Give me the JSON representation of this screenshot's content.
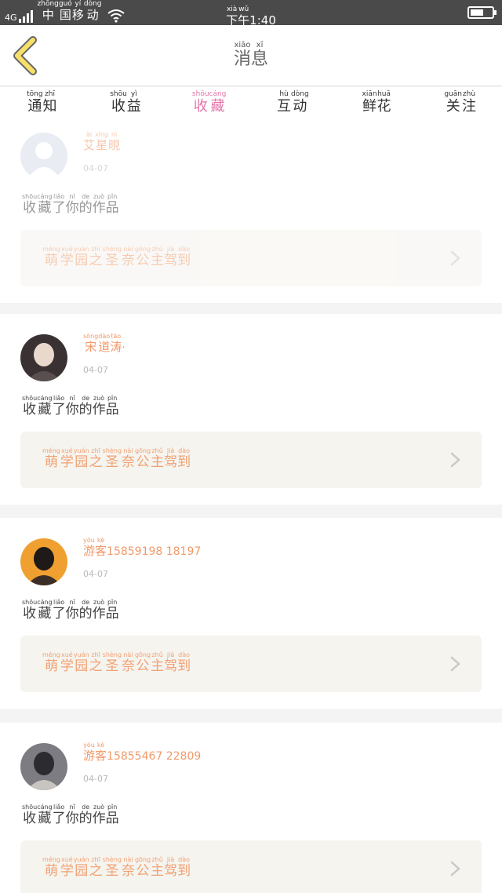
{
  "status_bar": {
    "network": "4G",
    "carrier": [
      {
        "char": "中",
        "py": "zhōng"
      },
      {
        "char": "国",
        "py": "guó"
      },
      {
        "char": "移",
        "py": "yí"
      },
      {
        "char": "动",
        "py": "dòng"
      }
    ],
    "time": [
      {
        "char": "下",
        "py": "xià"
      },
      {
        "char": "午",
        "py": "wǔ"
      },
      {
        "char": "1:40",
        "py": ""
      }
    ],
    "battery_level": 0.6
  },
  "header": {
    "back_icon": "chevron-left-icon",
    "title": [
      {
        "char": "消",
        "py": "xiāo"
      },
      {
        "char": "息",
        "py": "xī"
      }
    ]
  },
  "tabs": [
    {
      "chars": [
        {
          "char": "通",
          "py": "tōng"
        },
        {
          "char": "知",
          "py": "zhī"
        }
      ],
      "active": false
    },
    {
      "chars": [
        {
          "char": "收",
          "py": "shōu"
        },
        {
          "char": "益",
          "py": "yì"
        }
      ],
      "active": false
    },
    {
      "chars": [
        {
          "char": "收",
          "py": "shōu"
        },
        {
          "char": "藏",
          "py": "cáng"
        }
      ],
      "active": true
    },
    {
      "chars": [
        {
          "char": "互",
          "py": "hù"
        },
        {
          "char": "动",
          "py": "dòng"
        }
      ],
      "active": false
    },
    {
      "chars": [
        {
          "char": "鲜",
          "py": "xiān"
        },
        {
          "char": "花",
          "py": "huā"
        }
      ],
      "active": false
    },
    {
      "chars": [
        {
          "char": "关",
          "py": "guān"
        },
        {
          "char": "注",
          "py": "zhù"
        }
      ],
      "active": false
    }
  ],
  "action_text": [
    {
      "char": "收",
      "py": "shōu"
    },
    {
      "char": "藏",
      "py": "cáng"
    },
    {
      "char": "了",
      "py": "liǎo"
    },
    {
      "char": "你",
      "py": "nǐ"
    },
    {
      "char": "的",
      "py": "de"
    },
    {
      "char": "作",
      "py": "zuò"
    },
    {
      "char": "品",
      "py": "pǐn"
    }
  ],
  "work_title": [
    {
      "char": "萌",
      "py": "méng"
    },
    {
      "char": "学",
      "py": "xué"
    },
    {
      "char": "园",
      "py": "yuán"
    },
    {
      "char": "之",
      "py": "zhī"
    },
    {
      "char": "圣",
      "py": "shèng"
    },
    {
      "char": "奈",
      "py": "nài"
    },
    {
      "char": "公",
      "py": "gōng"
    },
    {
      "char": "主",
      "py": "zhǔ"
    },
    {
      "char": "驾",
      "py": "jià"
    },
    {
      "char": "到",
      "py": "dào"
    }
  ],
  "notifications": [
    {
      "avatar": "default-avatar-icon",
      "name": [
        {
          "char": "艾",
          "py": "ài"
        },
        {
          "char": "星",
          "py": "xīng"
        },
        {
          "char": "晛",
          "py": "nì"
        }
      ],
      "name_suffix": "",
      "date": "04-07",
      "faded": true
    },
    {
      "avatar": "user-photo-avatar",
      "name": [
        {
          "char": "宋",
          "py": "sòng"
        },
        {
          "char": "道",
          "py": "dào"
        },
        {
          "char": "涛",
          "py": "tāo"
        }
      ],
      "name_suffix": "·",
      "date": "04-07",
      "faded": false
    },
    {
      "avatar": "user-photo-avatar",
      "name": [
        {
          "char": "游",
          "py": "yóu"
        },
        {
          "char": "客",
          "py": "kè"
        }
      ],
      "name_suffix": "15859198 18197",
      "date": "04-07",
      "faded": false
    },
    {
      "avatar": "user-photo-avatar",
      "name": [
        {
          "char": "游",
          "py": "yóu"
        },
        {
          "char": "客",
          "py": "kè"
        }
      ],
      "name_suffix": "15855467 22809",
      "date": "04-07",
      "faded": false
    }
  ],
  "colors": {
    "accent": "#e475a8",
    "username": "#f09a6a",
    "work_title": "#f2a172",
    "statusbar": "#4a4a4a"
  }
}
